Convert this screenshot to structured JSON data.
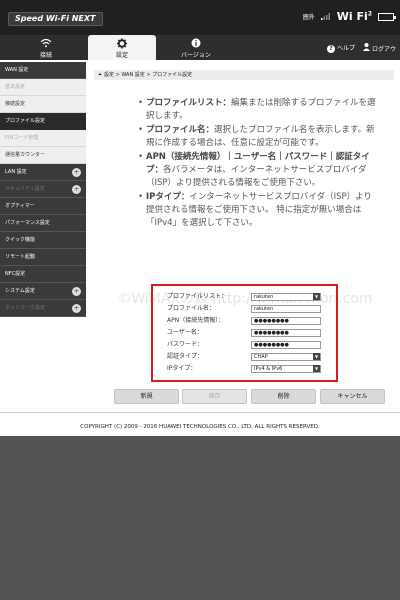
{
  "brand": "Speed Wi-Fi NEXT",
  "status": {
    "signal_label": "圏外",
    "wifi_label": "Wi Fi",
    "wifi_superscript": "2"
  },
  "nav": {
    "tabs": [
      {
        "label": "接続"
      },
      {
        "label": "設定"
      },
      {
        "label": "バージョン"
      }
    ],
    "help": "ヘルプ",
    "logout": "ログアウ"
  },
  "sidebar": {
    "items": [
      {
        "label": "WAN 設定"
      },
      {
        "label": "基本設定"
      },
      {
        "label": "接続設定"
      },
      {
        "label": "プロファイル設定"
      },
      {
        "label": "PINコード管理"
      },
      {
        "label": "通信量カウンター"
      },
      {
        "label": "LAN 設定"
      },
      {
        "label": "セキュリティ設定"
      },
      {
        "label": "オプティマー"
      },
      {
        "label": "パフォーマンス設定"
      },
      {
        "label": "クイック機能"
      },
      {
        "label": "リモート起動"
      },
      {
        "label": "NFC設定"
      },
      {
        "label": "システム設定"
      },
      {
        "label": "ネットワーク設定"
      }
    ]
  },
  "breadcrumb": "設定 > WAN 設定 > プロファイル設定",
  "help": {
    "items": [
      {
        "title": "プロファイルリスト：",
        "text": "編集または削除するプロファイルを選択します。"
      },
      {
        "title": "プロファイル名：",
        "text": "選択したプロファイル名を表示します。新規に作成する場合は、任意に設定が可能です。"
      },
      {
        "title": "APN（接続先情報）｜ユーザー名｜パスワード｜認証タイプ：",
        "text": "各パラメータは、インターネットサービスプロバイダ（ISP）より提供される情報をご使用下さい。"
      },
      {
        "title": "IPタイプ：",
        "text": "インターネットサービスプロバイダ（ISP）より提供される情報をご使用下さい。 特に指定が無い場合は「IPv4」を選択して下さい。"
      }
    ]
  },
  "watermark": "©WiMAXの森 http://wimax-mori.com",
  "form": {
    "profile_list": {
      "label": "プロファイルリスト：",
      "value": "rakuten"
    },
    "profile_name": {
      "label": "プロファイル名：",
      "value": "rakuten"
    },
    "apn": {
      "label": "APN（接続先情報）：",
      "value": "●●●●●●●●"
    },
    "username": {
      "label": "ユーザー名：",
      "value": "●●●●●●●●"
    },
    "password": {
      "label": "パスワード：",
      "value": "●●●●●●●●"
    },
    "auth_type": {
      "label": "認証タイプ：",
      "value": "CHAP"
    },
    "ip_type": {
      "label": "IPタイプ：",
      "value": "IPv4 & IPv6"
    }
  },
  "buttons": {
    "new": "新規",
    "save": "保存",
    "delete": "削除",
    "cancel": "キャンセル"
  },
  "footer": "COPYRIGHT (C) 2009 - 2016 HUAWEI TECHNOLOGIES CO., LTD. ALL RIGHTS RESERVED."
}
